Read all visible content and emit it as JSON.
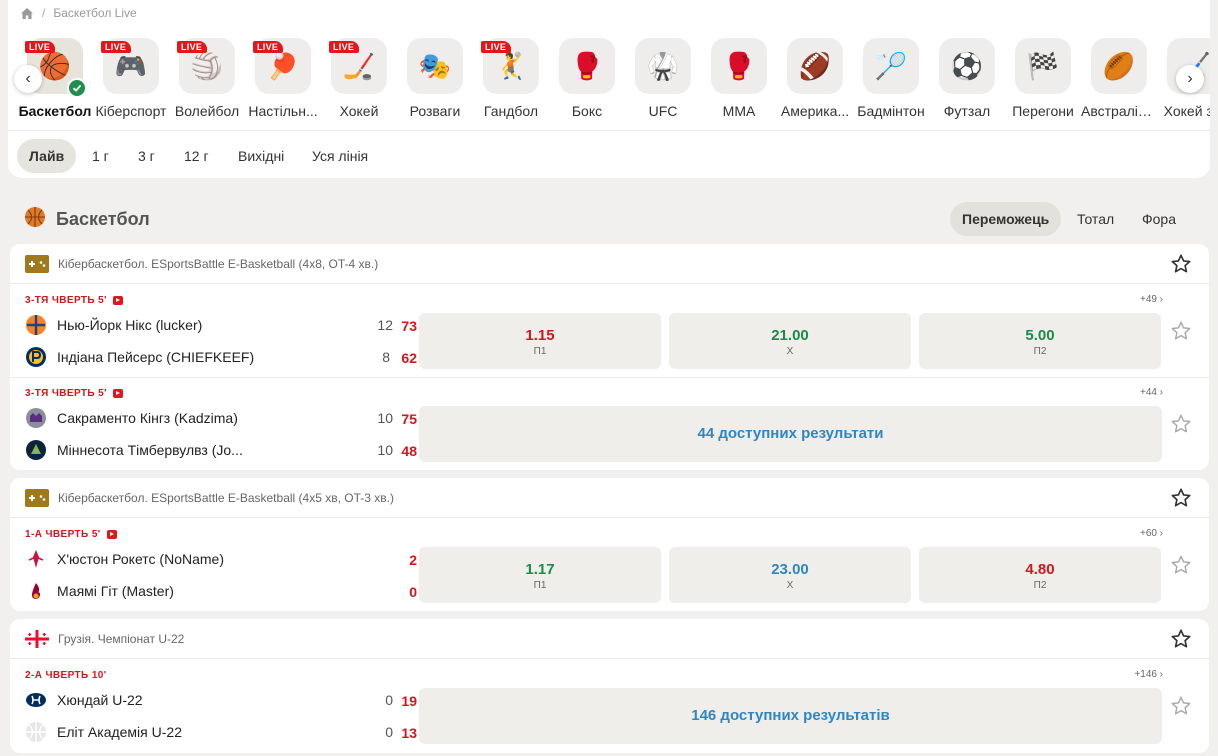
{
  "breadcrumb": {
    "current": "Баскетбол Live"
  },
  "sports": [
    {
      "label": "Баскетбол",
      "live": "LIVE",
      "emoji": "🏀",
      "icon": "basketball-icon",
      "active": true
    },
    {
      "label": "Кіберспорт",
      "live": "LIVE",
      "emoji": "🎮",
      "icon": "gamepad-icon"
    },
    {
      "label": "Волейбол",
      "live": "LIVE",
      "emoji": "🏐",
      "icon": "volleyball-icon"
    },
    {
      "label": "Настільн...",
      "live": "LIVE",
      "emoji": "🏓",
      "icon": "table-tennis-icon"
    },
    {
      "label": "Хокей",
      "live": "LIVE",
      "emoji": "🏒",
      "icon": "hockey-puck-icon"
    },
    {
      "label": "Розваги",
      "live": "",
      "emoji": "🎭",
      "icon": "mask-icon"
    },
    {
      "label": "Гандбол",
      "live": "LIVE",
      "emoji": "🤾",
      "icon": "handball-icon"
    },
    {
      "label": "Бокс",
      "live": "",
      "emoji": "🥊",
      "icon": "boxing-glove-icon"
    },
    {
      "label": "UFC",
      "live": "",
      "emoji": "🥋",
      "icon": "ufc-glove-icon"
    },
    {
      "label": "MMA",
      "live": "",
      "emoji": "🥊",
      "icon": "mma-glove-icon"
    },
    {
      "label": "Америка...",
      "live": "",
      "emoji": "🏈",
      "icon": "american-football-icon"
    },
    {
      "label": "Бадмінтон",
      "live": "",
      "emoji": "🏸",
      "icon": "shuttlecock-icon"
    },
    {
      "label": "Футзал",
      "live": "",
      "emoji": "⚽",
      "icon": "futsal-ball-icon"
    },
    {
      "label": "Перегони",
      "live": "",
      "emoji": "🏁",
      "icon": "checkered-flag-icon"
    },
    {
      "label": "Австралій...",
      "live": "",
      "emoji": "🏉",
      "icon": "aussie-football-icon"
    },
    {
      "label": "Хокей з м",
      "live": "",
      "emoji": "🏑",
      "icon": "field-hockey-icon"
    }
  ],
  "filters": [
    "Лайв",
    "1 г",
    "3 г",
    "12 г",
    "Вихідні",
    "Уся лінія"
  ],
  "section": {
    "title": "Баскетбол",
    "tabs": [
      "Переможець",
      "Тотал",
      "Фора"
    ]
  },
  "leagues": [
    {
      "name": "Кібербаскетбол. ESportsBattle E-Basketball (4x8, OT-4 хв.)",
      "events": [
        {
          "time": "3-ТЯ ЧВЕРТЬ 5'",
          "more": "+49",
          "team1": {
            "name": "Нью-Йорк Нікс (lucker)",
            "s1": "12",
            "s2": "73"
          },
          "team2": {
            "name": "Індіана Пейсерс (CHIEFKEEF)",
            "s1": "8",
            "s2": "62"
          },
          "odds": [
            {
              "value": "1.15",
              "label": "П1"
            },
            {
              "value": "21.00",
              "label": "Х"
            },
            {
              "value": "5.00",
              "label": "П2"
            }
          ]
        },
        {
          "time": "3-ТЯ ЧВЕРТЬ 5'",
          "more": "+44",
          "team1": {
            "name": "Сакраменто Кінгз (Kadzima)",
            "s1": "10",
            "s2": "75"
          },
          "team2": {
            "name": "Міннесота Тімбервулвз (Jo...",
            "s1": "10",
            "s2": "48"
          },
          "wide": "44 доступних результати"
        }
      ]
    },
    {
      "name": "Кібербаскетбол. ESportsBattle E-Basketball (4x5 хв, OT-3 хв.)",
      "events": [
        {
          "time": "1-А ЧВЕРТЬ 5'",
          "more": "+60",
          "team1": {
            "name": "Х'юстон Рокетс (NoName)",
            "s1": "",
            "s2": "2"
          },
          "team2": {
            "name": "Маямі Гіт (Master)",
            "s1": "",
            "s2": "0"
          },
          "odds": [
            {
              "value": "1.17",
              "label": "П1"
            },
            {
              "value": "23.00",
              "label": "Х"
            },
            {
              "value": "4.80",
              "label": "П2"
            }
          ]
        }
      ]
    },
    {
      "name": "Грузія. Чемпіонат U-22",
      "events": [
        {
          "time": "2-А ЧВЕРТЬ 10'",
          "more": "+146",
          "team1": {
            "name": "Хюндай U-22",
            "s1": "0",
            "s2": "19"
          },
          "team2": {
            "name": "Еліт Академія U-22",
            "s1": "0",
            "s2": "13"
          },
          "wide": "146 доступних результатів"
        }
      ]
    }
  ],
  "colors": {
    "live_red": "#e3161d",
    "odds_green": "#1d8a47",
    "odds_blue": "#2f86c4",
    "check_green": "#1f8f4e"
  }
}
